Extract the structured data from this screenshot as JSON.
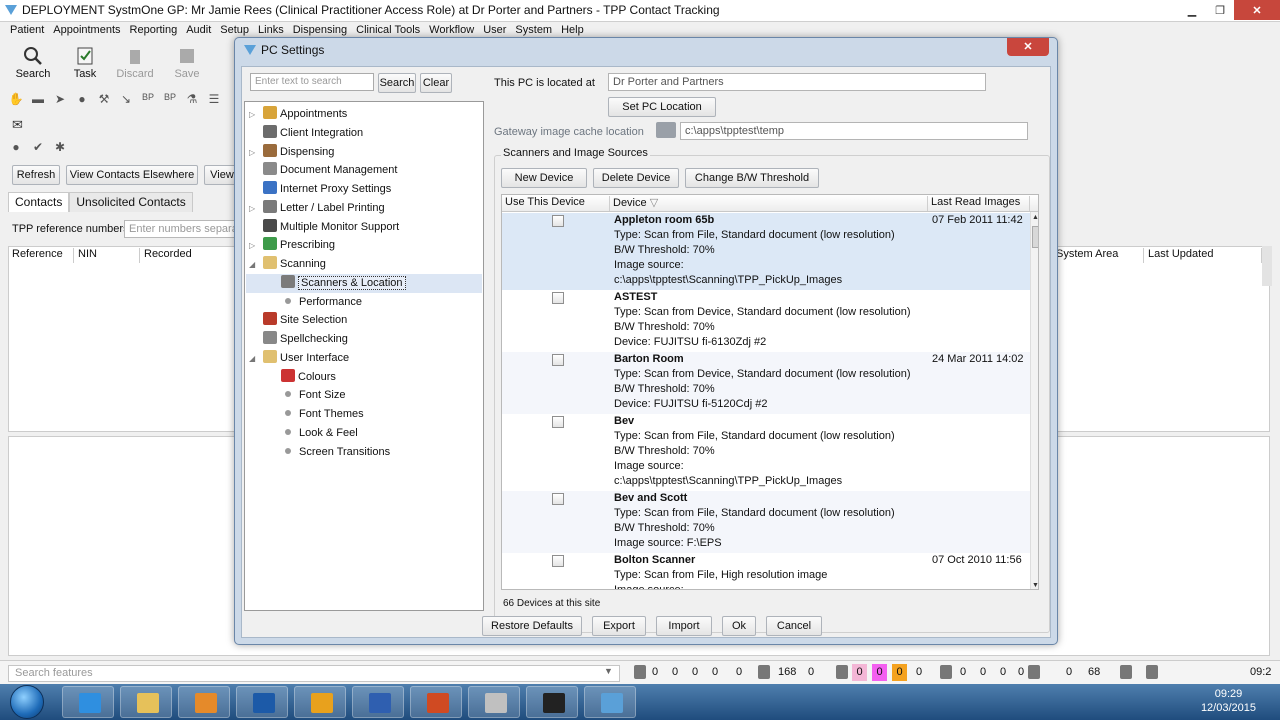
{
  "main_window": {
    "title": "DEPLOYMENT SystmOne GP: Mr Jamie Rees (Clinical Practitioner Access Role) at Dr Porter and Partners - TPP Contact Tracking",
    "menu": [
      "Patient",
      "Appointments",
      "Reporting",
      "Audit",
      "Setup",
      "Links",
      "Dispensing",
      "Clinical Tools",
      "Workflow",
      "User",
      "System",
      "Help"
    ],
    "toolbar": {
      "search": "Search",
      "task": "Task",
      "discard": "Discard",
      "save": "Save"
    },
    "buttons": {
      "refresh": "Refresh",
      "view_contacts": "View Contacts Elsewhere",
      "view": "View"
    },
    "tabs": [
      "Contacts",
      "Unsolicited Contacts"
    ],
    "ref_label": "TPP reference numbers",
    "ref_placeholder": "Enter numbers separa",
    "columns": [
      "Reference",
      "NIN",
      "Recorded"
    ],
    "right_columns": [
      "System Area",
      "Last Updated"
    ]
  },
  "dialog": {
    "title": "PC Settings",
    "search_placeholder": "Enter text to search",
    "search_btn": "Search",
    "clear_btn": "Clear",
    "tree": [
      {
        "label": "Appointments",
        "level": 0,
        "expander": "▷"
      },
      {
        "label": "Client Integration",
        "level": 0,
        "expander": ""
      },
      {
        "label": "Dispensing",
        "level": 0,
        "expander": "▷"
      },
      {
        "label": "Document Management",
        "level": 0,
        "expander": ""
      },
      {
        "label": "Internet Proxy Settings",
        "level": 0,
        "expander": ""
      },
      {
        "label": "Letter / Label Printing",
        "level": 0,
        "expander": "▷"
      },
      {
        "label": "Multiple Monitor Support",
        "level": 0,
        "expander": ""
      },
      {
        "label": "Prescribing",
        "level": 0,
        "expander": "▷"
      },
      {
        "label": "Scanning",
        "level": 0,
        "expander": "◢"
      },
      {
        "label": "Scanners & Location",
        "level": 1,
        "expander": ""
      },
      {
        "label": "Performance",
        "level": 1,
        "expander": ""
      },
      {
        "label": "Site Selection",
        "level": 0,
        "expander": ""
      },
      {
        "label": "Spellchecking",
        "level": 0,
        "expander": ""
      },
      {
        "label": "User Interface",
        "level": 0,
        "expander": "◢"
      },
      {
        "label": "Colours",
        "level": 1,
        "expander": ""
      },
      {
        "label": "Font Size",
        "level": 1,
        "expander": ""
      },
      {
        "label": "Font Themes",
        "level": 1,
        "expander": ""
      },
      {
        "label": "Look & Feel",
        "level": 1,
        "expander": ""
      },
      {
        "label": "Screen Transitions",
        "level": 1,
        "expander": ""
      }
    ],
    "location_label": "This PC is located at",
    "location_value": "Dr Porter and Partners",
    "set_location_btn": "Set PC Location",
    "cache_label": "Gateway image cache location",
    "cache_value": "c:\\apps\\tpptest\\temp",
    "group_title": "Scanners and Image Sources",
    "new_device_btn": "New Device",
    "delete_device_btn": "Delete Device",
    "threshold_btn": "Change B/W Threshold",
    "table_headers": [
      "Use This Device",
      "Device",
      "Last Read Images"
    ],
    "devices": [
      {
        "name": "Appleton  room 65b",
        "date": "07 Feb 2011 11:42",
        "lines": [
          "Type: Scan from File, Standard document (low resolution)",
          "B/W Threshold: 70%",
          "Image source:",
          "c:\\apps\\tpptest\\Scanning\\TPP_PickUp_Images"
        ]
      },
      {
        "name": "ASTEST",
        "date": "",
        "lines": [
          "Type: Scan from Device, Standard document (low resolution)",
          "B/W Threshold: 70%",
          "Device: FUJITSU fi-6130Zdj #2"
        ]
      },
      {
        "name": "Barton Room",
        "date": "24 Mar 2011 14:02",
        "lines": [
          "Type: Scan from Device, Standard document (low resolution)",
          "B/W Threshold: 70%",
          "Device: FUJITSU fi-5120Cdj #2"
        ]
      },
      {
        "name": "Bev",
        "date": "",
        "lines": [
          "Type: Scan from File, Standard document (low resolution)",
          "B/W Threshold: 70%",
          "Image source:",
          "c:\\apps\\tpptest\\Scanning\\TPP_PickUp_Images"
        ]
      },
      {
        "name": "Bev and Scott",
        "date": "",
        "lines": [
          "Type: Scan from File, Standard document (low resolution)",
          "B/W Threshold: 70%",
          "Image source: F:\\EPS"
        ]
      },
      {
        "name": "Bolton Scanner",
        "date": "07 Oct 2010 11:56",
        "lines": [
          "Type: Scan from File, High resolution image",
          "Image source:"
        ]
      }
    ],
    "device_count": "66 Devices at this site",
    "footer": {
      "restore": "Restore Defaults",
      "export": "Export",
      "import": "Import",
      "ok": "Ok",
      "cancel": "Cancel"
    }
  },
  "statusbar": {
    "search_placeholder": "Search features",
    "counts": [
      "0",
      "0",
      "0",
      "0",
      "0",
      "168",
      "0",
      "0",
      "0",
      "0",
      "0",
      "0",
      "0",
      "0",
      "0",
      "0",
      "68"
    ],
    "badge_colors": [
      "#f4b6d6",
      "#f45ff0",
      "#f5a21f"
    ],
    "time_short": "09:2"
  },
  "taskbar": {
    "time": "09:29",
    "date": "12/03/2015",
    "apps": [
      "ie-icon",
      "explorer-icon",
      "media-icon",
      "captivate-icon",
      "outlook-icon",
      "word-icon",
      "powerpoint-icon",
      "snipping-icon",
      "cmd-icon",
      "systmone-icon"
    ]
  }
}
